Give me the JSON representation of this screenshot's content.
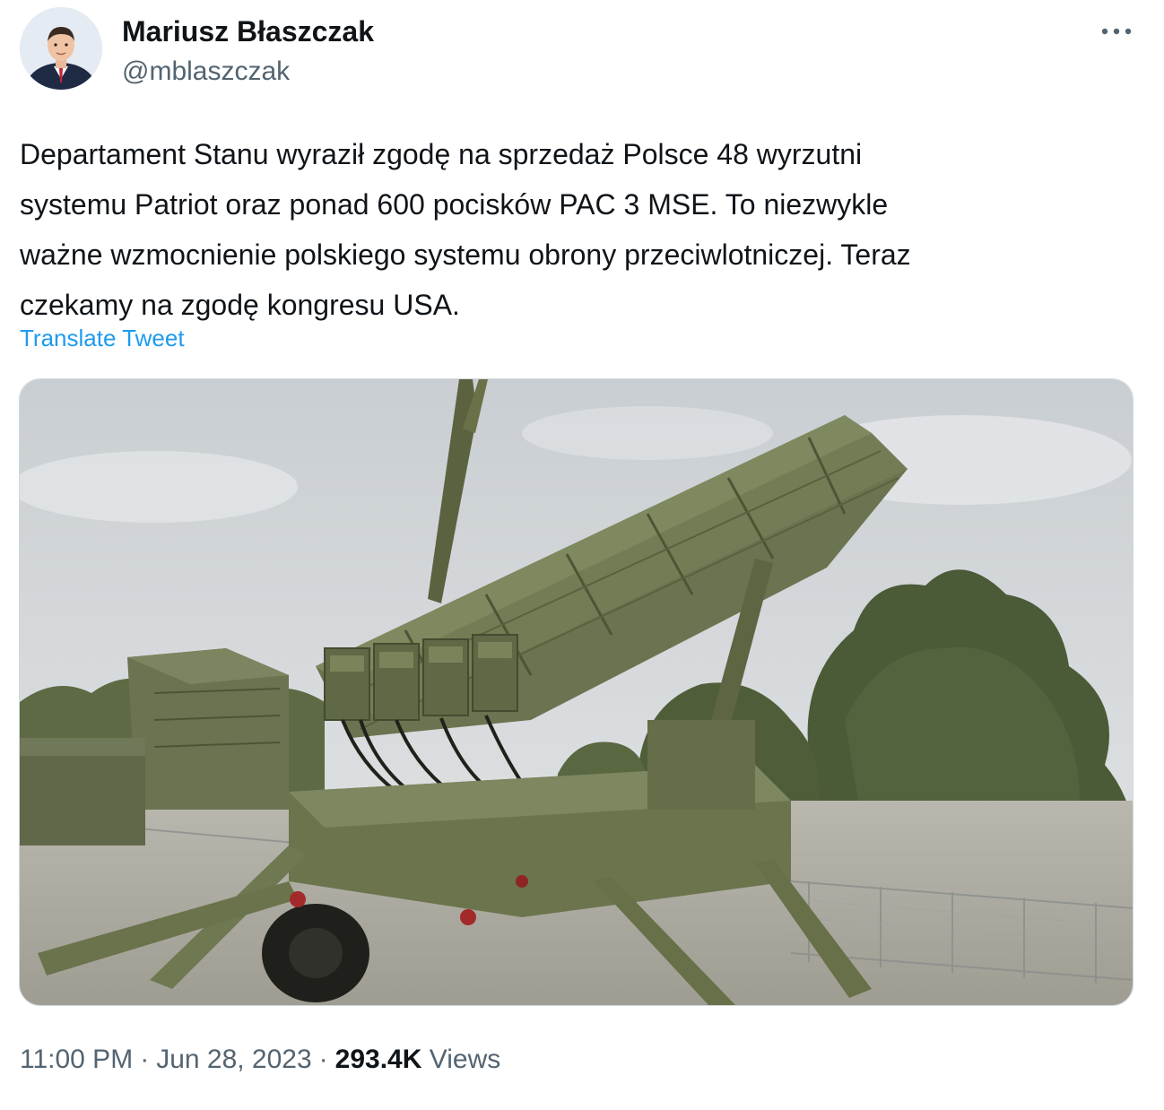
{
  "author": {
    "name": "Mariusz Błaszczak",
    "handle": "@mblaszczak",
    "avatar_icon": "profile-photo"
  },
  "more_icon": "more-horizontal-icon",
  "tweet": {
    "text": "Departament Stanu wyraził zgodę na sprzedaż Polsce 48 wyrzutni\nsystemu Patriot oraz ponad 600 pocisków PAC 3 MSE. To niezwykle\nważne wzmocnienie polskiego systemu obrony przeciwlotniczej. Teraz\nczekamy na zgodę kongresu USA.",
    "translate_label": "Translate Tweet"
  },
  "media": {
    "subject": "Patriot missile launcher photo"
  },
  "meta": {
    "time": "11:00 PM",
    "separator": "·",
    "date": "Jun 28, 2023",
    "views_count": "293.4K",
    "views_label": "Views"
  },
  "colors": {
    "link": "#1d9bf0",
    "secondary_text": "#536471",
    "primary_text": "#0f1419"
  }
}
